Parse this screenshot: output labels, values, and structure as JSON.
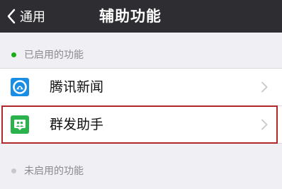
{
  "navbar": {
    "back_label": "通用",
    "title": "辅助功能",
    "background": "#2e2e32"
  },
  "enabled_section": {
    "label": "已启用的功能",
    "dot_color": "#1aad19",
    "items": [
      {
        "name": "腾讯新闻",
        "icon": "tencent-news-icon",
        "icon_color": "#1a8ee5"
      },
      {
        "name": "群发助手",
        "icon": "mass-message-assistant-icon",
        "icon_color": "#2bb24c"
      }
    ]
  },
  "disabled_section": {
    "label": "未启用的功能",
    "dot_color": "#c7c7cc"
  },
  "highlight_color": "#b0272c"
}
